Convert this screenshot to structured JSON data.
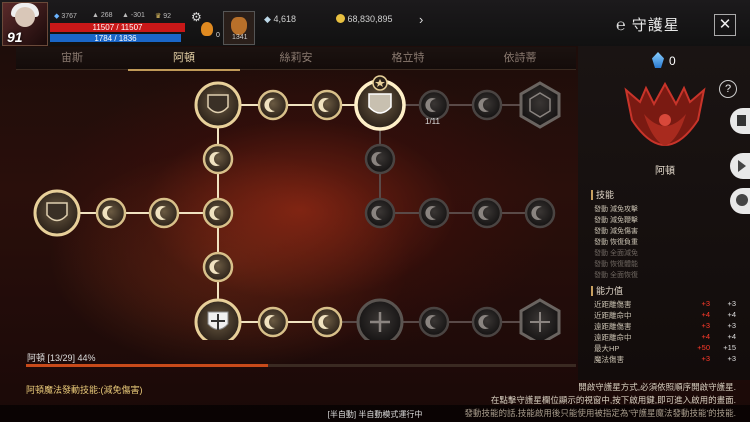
{
  "player": {
    "level": "91",
    "stat1": "3767",
    "stat2": "268",
    "stat3": "301",
    "stat4": "92",
    "hp": "11507 / 11507",
    "mp": "1784 / 1836",
    "hp_fraction": 1.0,
    "mp_fraction": 0.97
  },
  "inventory": {
    "item1_count": "0",
    "item2_count": "1341"
  },
  "currency": {
    "gem": "4,618",
    "gold": "68,830,895"
  },
  "window": {
    "title": "守護星",
    "close_label": "✕"
  },
  "tabs": [
    {
      "label": "宙斯",
      "active": false
    },
    {
      "label": "阿頓",
      "active": true
    },
    {
      "label": "絲莉安",
      "active": false
    },
    {
      "label": "格立特",
      "active": false
    },
    {
      "label": "依詩蒂",
      "active": false
    }
  ],
  "graph": {
    "node_counter_label": "1/11"
  },
  "progress": {
    "text": "阿頓 [13/29] 44%",
    "fraction": 0.44
  },
  "skill_description": "阿頓魔法發動技能:(減免傷害)",
  "notice": [
    "開啟守護星方式,必須依照順序開啟守護星.",
    "在點擊守護星欄位顯示的視窗中,按下啟用鍵,即可進入啟用的畫面.",
    "發動技能的話,技能啟用後只能使用被指定為'守護星魔法發動技能'的技能."
  ],
  "auto_mode": "[半自動] 半自動模式運行中",
  "panel": {
    "crystal_count": "0",
    "help_label": "?",
    "emblem_name": "阿頓",
    "skills_title": "技能",
    "skills": [
      {
        "text": "發動 減免攻擊",
        "dim": false
      },
      {
        "text": "發動 減免鞭擊",
        "dim": false
      },
      {
        "text": "發動 減免傷害",
        "dim": false
      },
      {
        "text": "發動 恢復負重",
        "dim": false
      },
      {
        "text": "發動 全面減免",
        "dim": true
      },
      {
        "text": "發動 恢復體能",
        "dim": true
      },
      {
        "text": "發動 全面恢復",
        "dim": true
      }
    ],
    "stats_title": "能力值",
    "stats": [
      {
        "name": "近距離傷害",
        "add": "+3",
        "total": "+3"
      },
      {
        "name": "近距離命中",
        "add": "+4",
        "total": "+4"
      },
      {
        "name": "遠距離傷害",
        "add": "+3",
        "total": "+3"
      },
      {
        "name": "遠距離命中",
        "add": "+4",
        "total": "+4"
      },
      {
        "name": "最大HP",
        "add": "+50",
        "total": "+15"
      },
      {
        "name": "魔法傷害",
        "add": "+3",
        "total": "+3"
      }
    ]
  },
  "colors": {
    "accent": "#c8a060",
    "lit_line": "#f0e2c0",
    "dim_line": "#5a4a48",
    "hp": "#c81818",
    "mp": "#1a66c8",
    "progress": "#c84a1a"
  }
}
